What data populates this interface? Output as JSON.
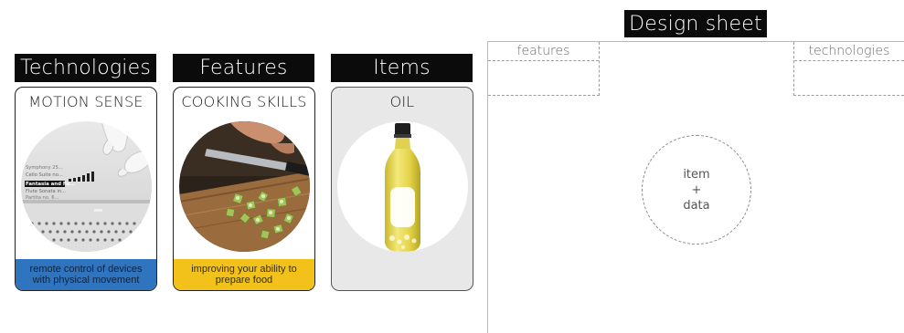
{
  "columns": {
    "technologies": {
      "header": "Technologies",
      "card_title": "MOTION SENSE",
      "caption": "remote control of devices with physical movement",
      "screen_lines": [
        "Symphony 25...",
        "Cello Suite no...",
        "Fantasia and Fu...",
        "Flute Sonata in...",
        "Partita no. 6..."
      ]
    },
    "features": {
      "header": "Features",
      "card_title": "COOKING SKILLS",
      "caption": "improving your ability to prepare food"
    },
    "items": {
      "header": "Items",
      "card_title": "OIL"
    }
  },
  "design_sheet": {
    "title": "Design sheet",
    "features_label": "features",
    "technologies_label": "technologies",
    "center": {
      "line1": "item",
      "line2": "+",
      "line3": "data"
    }
  },
  "colors": {
    "header_bg": "#0b0b0b",
    "tech_caption_bg": "#2f74be",
    "feature_caption_bg": "#f2c21b",
    "items_card_bg": "#e8e8e8"
  }
}
